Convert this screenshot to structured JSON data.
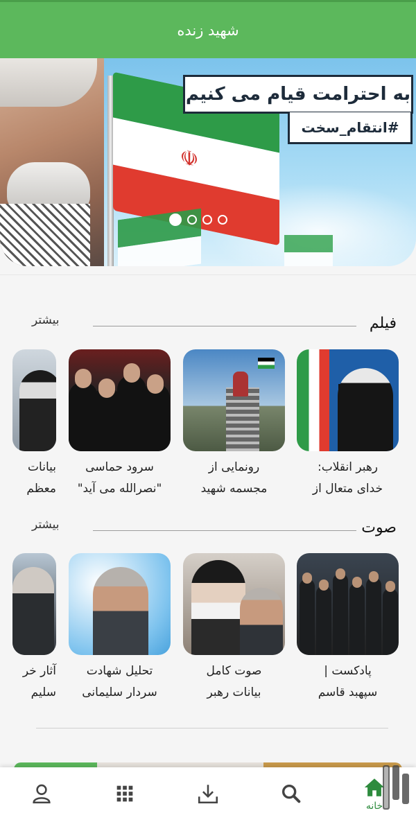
{
  "app": {
    "title": "شهید زنده"
  },
  "banner": {
    "headline": "به احترامت قیام می کنیم",
    "hashtag": "#انتقام_سخت",
    "slides_count": 4,
    "active_slide": 1
  },
  "sections": [
    {
      "title": "فیلم",
      "more_label": "بیشتر",
      "items": [
        {
          "line1": "رهبر انقلاب:",
          "line2": "خدای متعال از"
        },
        {
          "line1": "رونمایی از",
          "line2": "مجسمه شهید"
        },
        {
          "line1": "سرود حماسی",
          "line2": "\"نصرالله می آید\""
        },
        {
          "line1": "بیانات",
          "line2": "معظم"
        }
      ]
    },
    {
      "title": "صوت",
      "more_label": "بیشتر",
      "items": [
        {
          "line1": "پادکست |",
          "line2": "سپهبد قاسم"
        },
        {
          "line1": "صوت کامل",
          "line2": "بیانات رهبر"
        },
        {
          "line1": "تحلیل شهادت",
          "line2": "سردار سلیمانی"
        },
        {
          "line1": "آثار خر",
          "line2": "سلیم"
        }
      ]
    }
  ],
  "bottom_nav": {
    "items": [
      {
        "label": "خانه",
        "icon": "home-icon",
        "active": true
      },
      {
        "label": "",
        "icon": "search-icon",
        "active": false
      },
      {
        "label": "",
        "icon": "download-icon",
        "active": false
      },
      {
        "label": "",
        "icon": "grid-icon",
        "active": false
      },
      {
        "label": "",
        "icon": "user-icon",
        "active": false
      }
    ]
  },
  "colors": {
    "primary": "#5cb85c",
    "active_nav": "#2e8b3e"
  }
}
